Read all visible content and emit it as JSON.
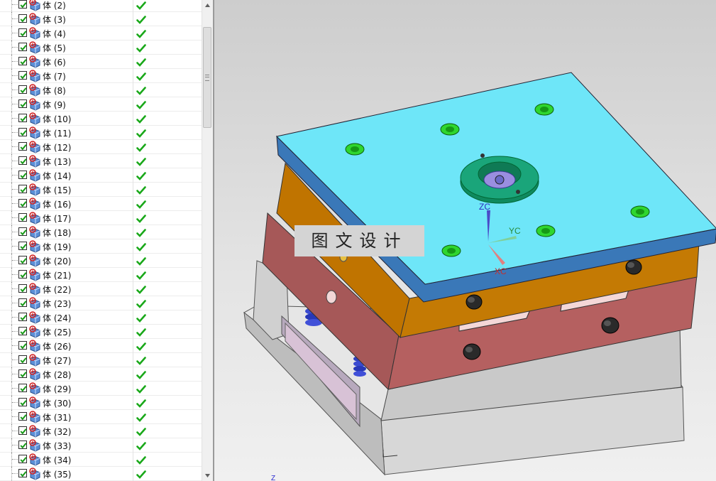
{
  "navigator": {
    "rows": [
      {
        "label": "体 (2)"
      },
      {
        "label": "体 (3)"
      },
      {
        "label": "体 (4)"
      },
      {
        "label": "体 (5)"
      },
      {
        "label": "体 (6)"
      },
      {
        "label": "体 (7)"
      },
      {
        "label": "体 (8)"
      },
      {
        "label": "体 (9)"
      },
      {
        "label": "体 (10)"
      },
      {
        "label": "体 (11)"
      },
      {
        "label": "体 (12)"
      },
      {
        "label": "体 (13)"
      },
      {
        "label": "体 (14)"
      },
      {
        "label": "体 (15)"
      },
      {
        "label": "体 (16)"
      },
      {
        "label": "体 (17)"
      },
      {
        "label": "体 (18)"
      },
      {
        "label": "体 (19)"
      },
      {
        "label": "体 (20)"
      },
      {
        "label": "体 (21)"
      },
      {
        "label": "体 (22)"
      },
      {
        "label": "体 (23)"
      },
      {
        "label": "体 (24)"
      },
      {
        "label": "体 (25)"
      },
      {
        "label": "体 (26)"
      },
      {
        "label": "体 (27)"
      },
      {
        "label": "体 (28)"
      },
      {
        "label": "体 (29)"
      },
      {
        "label": "体 (30)"
      },
      {
        "label": "体 (31)"
      },
      {
        "label": "体 (32)"
      },
      {
        "label": "体 (33)"
      },
      {
        "label": "体 (34)"
      },
      {
        "label": "体 (35)"
      }
    ],
    "row_icons": [
      "checkbox-checked-icon",
      "solid-body-icon",
      "up-to-date-check-icon"
    ]
  },
  "viewport": {
    "watermark": "图文设计",
    "axes": {
      "zc": "ZC",
      "yc": "YC",
      "xc": "XC",
      "z": "Z"
    }
  },
  "colors": {
    "top_clamp_plate": "#6ee6f8",
    "plate_edge": "#3a78b8",
    "a_plate": "#c07400",
    "b_plate": "#b56060",
    "bottom_plate": "#c9c9c9",
    "locating_ring": "#1aa57a",
    "screw_head": "#2fd62f",
    "check_green": "#19a819"
  }
}
